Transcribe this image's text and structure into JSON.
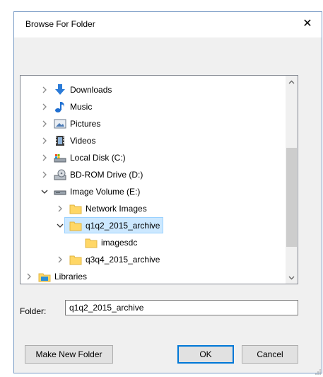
{
  "dialog": {
    "title": "Browse For Folder",
    "close_glyph": "✕"
  },
  "tree": {
    "items": [
      {
        "label": "Downloads",
        "icon": "download-arrow-icon",
        "expand": "collapsed"
      },
      {
        "label": "Music",
        "icon": "music-note-icon",
        "expand": "collapsed"
      },
      {
        "label": "Pictures",
        "icon": "pictures-icon",
        "expand": "collapsed"
      },
      {
        "label": "Videos",
        "icon": "videos-icon",
        "expand": "collapsed"
      },
      {
        "label": "Local Disk (C:)",
        "icon": "local-disk-icon",
        "expand": "collapsed"
      },
      {
        "label": "BD-ROM Drive (D:)",
        "icon": "bd-rom-drive-icon",
        "expand": "collapsed"
      },
      {
        "label": "Image Volume (E:)",
        "icon": "drive-icon",
        "expand": "expanded"
      },
      {
        "label": "Network Images",
        "icon": "folder-icon",
        "expand": "collapsed"
      },
      {
        "label": "q1q2_2015_archive",
        "icon": "folder-icon",
        "expand": "expanded",
        "selected": true
      },
      {
        "label": "imagesdc",
        "icon": "folder-icon",
        "expand": "none"
      },
      {
        "label": "q3q4_2015_archive",
        "icon": "folder-icon",
        "expand": "collapsed"
      },
      {
        "label": "Libraries",
        "icon": "libraries-icon",
        "expand": "collapsed"
      }
    ]
  },
  "folder": {
    "label": "Folder:",
    "value": "q1q2_2015_archive"
  },
  "buttons": {
    "make_new_folder": "Make New Folder",
    "ok": "OK",
    "cancel": "Cancel"
  },
  "colors": {
    "selection_bg": "#cce8ff",
    "folder_yellow": "#ffd766",
    "accent_blue": "#0078d7"
  }
}
